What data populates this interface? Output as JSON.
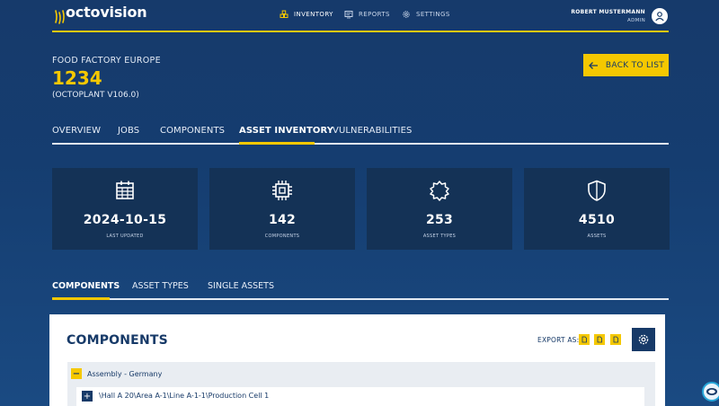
{
  "brand": {
    "name": "octovision",
    "accent": "#f5c800",
    "primary": "#173a68"
  },
  "nav": {
    "inventory": {
      "label": "INVENTORY",
      "icon": "inventory-icon"
    },
    "reports": {
      "label": "REPORTS",
      "icon": "reports-icon"
    },
    "settings": {
      "label": "SETTINGS",
      "icon": "gear-icon"
    }
  },
  "user": {
    "name": "ROBERT MUSTERMANN",
    "role": "ADMIN",
    "icon": "user-icon"
  },
  "plant": {
    "company": "FOOD FACTORY EUROPE",
    "id": "1234",
    "version": "(OCTOPLANT V106.0)"
  },
  "back_button": {
    "label": "BACK TO LIST",
    "icon": "arrow-left-icon"
  },
  "tabs": [
    {
      "label": "OVERVIEW"
    },
    {
      "label": "JOBS"
    },
    {
      "label": "COMPONENTS"
    },
    {
      "label": "ASSET INVENTORY",
      "active": true
    },
    {
      "label": "VULNERABILITIES"
    }
  ],
  "stats": [
    {
      "value": "2024-10-15",
      "label": "LAST UPDATED",
      "icon": "calendar-icon"
    },
    {
      "value": "142",
      "label": "COMPONENTS",
      "icon": "chip-icon"
    },
    {
      "value": "253",
      "label": "ASSET TYPES",
      "icon": "puzzle-icon"
    },
    {
      "value": "4510",
      "label": "ASSETS",
      "icon": "shield-icon"
    }
  ],
  "subtabs": [
    {
      "label": "COMPONENTS",
      "active": true
    },
    {
      "label": "ASSET TYPES"
    },
    {
      "label": "SINGLE ASSETS"
    }
  ],
  "panel": {
    "title": "COMPONENTS",
    "export_label": "EXPORT AS:",
    "export_icons": [
      "pdf-icon",
      "csv-icon",
      "excel-icon"
    ],
    "settings_icon": "gear-icon"
  },
  "tree": {
    "group_label": "Assembly - Germany",
    "group_toggle": "−",
    "child_label": "\\Hall A 20\\Area A-1\\Line A-1-1\\Production Cell 1",
    "child_toggle": "+"
  }
}
